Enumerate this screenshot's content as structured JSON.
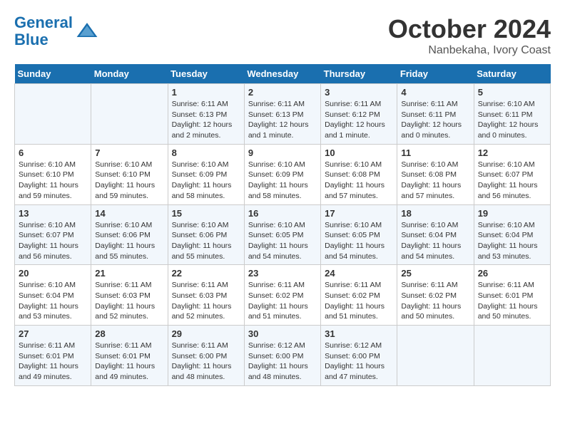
{
  "header": {
    "logo_line1": "General",
    "logo_line2": "Blue",
    "month": "October 2024",
    "location": "Nanbekaha, Ivory Coast"
  },
  "days_of_week": [
    "Sunday",
    "Monday",
    "Tuesday",
    "Wednesday",
    "Thursday",
    "Friday",
    "Saturday"
  ],
  "weeks": [
    [
      {
        "day": "",
        "sunrise": "",
        "sunset": "",
        "daylight": ""
      },
      {
        "day": "",
        "sunrise": "",
        "sunset": "",
        "daylight": ""
      },
      {
        "day": "1",
        "sunrise": "Sunrise: 6:11 AM",
        "sunset": "Sunset: 6:13 PM",
        "daylight": "Daylight: 12 hours and 2 minutes."
      },
      {
        "day": "2",
        "sunrise": "Sunrise: 6:11 AM",
        "sunset": "Sunset: 6:13 PM",
        "daylight": "Daylight: 12 hours and 1 minute."
      },
      {
        "day": "3",
        "sunrise": "Sunrise: 6:11 AM",
        "sunset": "Sunset: 6:12 PM",
        "daylight": "Daylight: 12 hours and 1 minute."
      },
      {
        "day": "4",
        "sunrise": "Sunrise: 6:11 AM",
        "sunset": "Sunset: 6:11 PM",
        "daylight": "Daylight: 12 hours and 0 minutes."
      },
      {
        "day": "5",
        "sunrise": "Sunrise: 6:10 AM",
        "sunset": "Sunset: 6:11 PM",
        "daylight": "Daylight: 12 hours and 0 minutes."
      }
    ],
    [
      {
        "day": "6",
        "sunrise": "Sunrise: 6:10 AM",
        "sunset": "Sunset: 6:10 PM",
        "daylight": "Daylight: 11 hours and 59 minutes."
      },
      {
        "day": "7",
        "sunrise": "Sunrise: 6:10 AM",
        "sunset": "Sunset: 6:10 PM",
        "daylight": "Daylight: 11 hours and 59 minutes."
      },
      {
        "day": "8",
        "sunrise": "Sunrise: 6:10 AM",
        "sunset": "Sunset: 6:09 PM",
        "daylight": "Daylight: 11 hours and 58 minutes."
      },
      {
        "day": "9",
        "sunrise": "Sunrise: 6:10 AM",
        "sunset": "Sunset: 6:09 PM",
        "daylight": "Daylight: 11 hours and 58 minutes."
      },
      {
        "day": "10",
        "sunrise": "Sunrise: 6:10 AM",
        "sunset": "Sunset: 6:08 PM",
        "daylight": "Daylight: 11 hours and 57 minutes."
      },
      {
        "day": "11",
        "sunrise": "Sunrise: 6:10 AM",
        "sunset": "Sunset: 6:08 PM",
        "daylight": "Daylight: 11 hours and 57 minutes."
      },
      {
        "day": "12",
        "sunrise": "Sunrise: 6:10 AM",
        "sunset": "Sunset: 6:07 PM",
        "daylight": "Daylight: 11 hours and 56 minutes."
      }
    ],
    [
      {
        "day": "13",
        "sunrise": "Sunrise: 6:10 AM",
        "sunset": "Sunset: 6:07 PM",
        "daylight": "Daylight: 11 hours and 56 minutes."
      },
      {
        "day": "14",
        "sunrise": "Sunrise: 6:10 AM",
        "sunset": "Sunset: 6:06 PM",
        "daylight": "Daylight: 11 hours and 55 minutes."
      },
      {
        "day": "15",
        "sunrise": "Sunrise: 6:10 AM",
        "sunset": "Sunset: 6:06 PM",
        "daylight": "Daylight: 11 hours and 55 minutes."
      },
      {
        "day": "16",
        "sunrise": "Sunrise: 6:10 AM",
        "sunset": "Sunset: 6:05 PM",
        "daylight": "Daylight: 11 hours and 54 minutes."
      },
      {
        "day": "17",
        "sunrise": "Sunrise: 6:10 AM",
        "sunset": "Sunset: 6:05 PM",
        "daylight": "Daylight: 11 hours and 54 minutes."
      },
      {
        "day": "18",
        "sunrise": "Sunrise: 6:10 AM",
        "sunset": "Sunset: 6:04 PM",
        "daylight": "Daylight: 11 hours and 54 minutes."
      },
      {
        "day": "19",
        "sunrise": "Sunrise: 6:10 AM",
        "sunset": "Sunset: 6:04 PM",
        "daylight": "Daylight: 11 hours and 53 minutes."
      }
    ],
    [
      {
        "day": "20",
        "sunrise": "Sunrise: 6:10 AM",
        "sunset": "Sunset: 6:04 PM",
        "daylight": "Daylight: 11 hours and 53 minutes."
      },
      {
        "day": "21",
        "sunrise": "Sunrise: 6:11 AM",
        "sunset": "Sunset: 6:03 PM",
        "daylight": "Daylight: 11 hours and 52 minutes."
      },
      {
        "day": "22",
        "sunrise": "Sunrise: 6:11 AM",
        "sunset": "Sunset: 6:03 PM",
        "daylight": "Daylight: 11 hours and 52 minutes."
      },
      {
        "day": "23",
        "sunrise": "Sunrise: 6:11 AM",
        "sunset": "Sunset: 6:02 PM",
        "daylight": "Daylight: 11 hours and 51 minutes."
      },
      {
        "day": "24",
        "sunrise": "Sunrise: 6:11 AM",
        "sunset": "Sunset: 6:02 PM",
        "daylight": "Daylight: 11 hours and 51 minutes."
      },
      {
        "day": "25",
        "sunrise": "Sunrise: 6:11 AM",
        "sunset": "Sunset: 6:02 PM",
        "daylight": "Daylight: 11 hours and 50 minutes."
      },
      {
        "day": "26",
        "sunrise": "Sunrise: 6:11 AM",
        "sunset": "Sunset: 6:01 PM",
        "daylight": "Daylight: 11 hours and 50 minutes."
      }
    ],
    [
      {
        "day": "27",
        "sunrise": "Sunrise: 6:11 AM",
        "sunset": "Sunset: 6:01 PM",
        "daylight": "Daylight: 11 hours and 49 minutes."
      },
      {
        "day": "28",
        "sunrise": "Sunrise: 6:11 AM",
        "sunset": "Sunset: 6:01 PM",
        "daylight": "Daylight: 11 hours and 49 minutes."
      },
      {
        "day": "29",
        "sunrise": "Sunrise: 6:11 AM",
        "sunset": "Sunset: 6:00 PM",
        "daylight": "Daylight: 11 hours and 48 minutes."
      },
      {
        "day": "30",
        "sunrise": "Sunrise: 6:12 AM",
        "sunset": "Sunset: 6:00 PM",
        "daylight": "Daylight: 11 hours and 48 minutes."
      },
      {
        "day": "31",
        "sunrise": "Sunrise: 6:12 AM",
        "sunset": "Sunset: 6:00 PM",
        "daylight": "Daylight: 11 hours and 47 minutes."
      },
      {
        "day": "",
        "sunrise": "",
        "sunset": "",
        "daylight": ""
      },
      {
        "day": "",
        "sunrise": "",
        "sunset": "",
        "daylight": ""
      }
    ]
  ]
}
